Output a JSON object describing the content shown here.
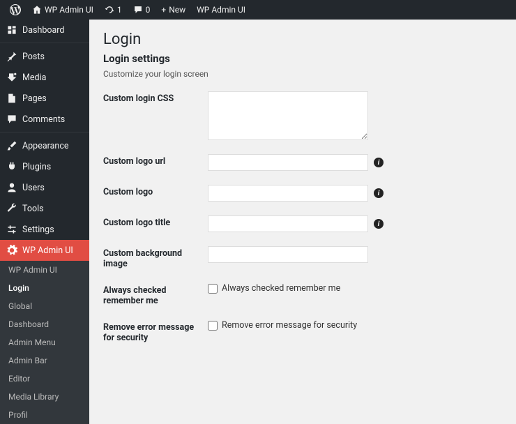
{
  "topbar": {
    "site_name": "WP Admin UI",
    "updates_count": "1",
    "comments_count": "0",
    "new_label": "New",
    "right_label": "WP Admin UI"
  },
  "sidebar": {
    "items": [
      {
        "label": "Dashboard"
      },
      {
        "label": "Posts"
      },
      {
        "label": "Media"
      },
      {
        "label": "Pages"
      },
      {
        "label": "Comments"
      },
      {
        "label": "Appearance"
      },
      {
        "label": "Plugins"
      },
      {
        "label": "Users"
      },
      {
        "label": "Tools"
      },
      {
        "label": "Settings"
      },
      {
        "label": "WP Admin UI"
      }
    ],
    "submenu": {
      "items": [
        {
          "label": "WP Admin UI"
        },
        {
          "label": "Login"
        },
        {
          "label": "Global"
        },
        {
          "label": "Dashboard"
        },
        {
          "label": "Admin Menu"
        },
        {
          "label": "Admin Bar"
        },
        {
          "label": "Editor"
        },
        {
          "label": "Media Library"
        },
        {
          "label": "Profil"
        }
      ]
    }
  },
  "page": {
    "title": "Login",
    "subtitle": "Login settings",
    "description": "Customize your login screen",
    "fields": {
      "custom_css": {
        "label": "Custom login CSS",
        "value": ""
      },
      "logo_url": {
        "label": "Custom logo url",
        "value": ""
      },
      "logo": {
        "label": "Custom logo",
        "value": ""
      },
      "logo_title": {
        "label": "Custom logo title",
        "value": ""
      },
      "bg_image": {
        "label": "Custom background image",
        "value": ""
      },
      "remember": {
        "label": "Always checked remember me",
        "checkbox_label": "Always checked remember me"
      },
      "remove_error": {
        "label": "Remove error message for security",
        "checkbox_label": "Remove error message for security"
      }
    }
  }
}
